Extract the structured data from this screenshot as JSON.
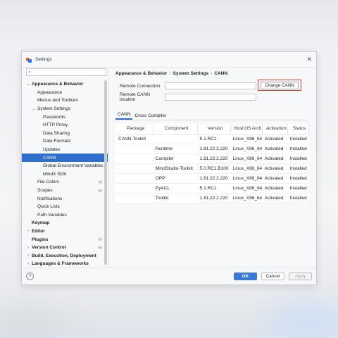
{
  "window": {
    "title": "Settings"
  },
  "sidebar": {
    "search_placeholder": "",
    "items": [
      {
        "label": "Appearance & Behavior",
        "depth": 0,
        "chevron": "expanded",
        "bold": true
      },
      {
        "label": "Appearance",
        "depth": 1
      },
      {
        "label": "Menus and Toolbars",
        "depth": 1
      },
      {
        "label": "System Settings",
        "depth": 1,
        "chevron": "expanded"
      },
      {
        "label": "Passwords",
        "depth": 2
      },
      {
        "label": "HTTP Proxy",
        "depth": 2
      },
      {
        "label": "Data Sharing",
        "depth": 2
      },
      {
        "label": "Date Formats",
        "depth": 2
      },
      {
        "label": "Updates",
        "depth": 2
      },
      {
        "label": "CANN",
        "depth": 2,
        "selected": true
      },
      {
        "label": "Global Environment Variables",
        "depth": 2
      },
      {
        "label": "MindX SDK",
        "depth": 2
      },
      {
        "label": "File Colors",
        "depth": 1,
        "page_icon": true
      },
      {
        "label": "Scopes",
        "depth": 1,
        "page_icon": true
      },
      {
        "label": "Notifications",
        "depth": 1
      },
      {
        "label": "Quick Lists",
        "depth": 1
      },
      {
        "label": "Path Variables",
        "depth": 1
      },
      {
        "label": "Keymap",
        "depth": 0,
        "bold": true
      },
      {
        "label": "Editor",
        "depth": 0,
        "chevron": "collapsed",
        "bold": true
      },
      {
        "label": "Plugins",
        "depth": 0,
        "bold": true,
        "page_icon": true
      },
      {
        "label": "Version Control",
        "depth": 0,
        "chevron": "collapsed",
        "bold": true,
        "page_icon": true
      },
      {
        "label": "Build, Execution, Deployment",
        "depth": 0,
        "chevron": "collapsed",
        "bold": true
      },
      {
        "label": "Languages & Frameworks",
        "depth": 0,
        "chevron": "collapsed",
        "bold": true
      }
    ]
  },
  "breadcrumb": [
    "Appearance & Behavior",
    "System Settings",
    "CANN"
  ],
  "form": {
    "remote_connection_label": "Remote Connection",
    "remote_connection_value": "",
    "remote_cann_location_label": "Remote CANN location",
    "remote_cann_location_value": "",
    "change_cann_label": "Change CANN"
  },
  "tabs": [
    "CANN",
    "Cross Compiler"
  ],
  "table": {
    "headers": [
      "Package",
      "Component",
      "Version",
      "Host OS Arch",
      "Activation",
      "Status"
    ],
    "rows": [
      [
        "CANN-Toolkit",
        "",
        "5.1.RC1",
        "Linux_X86_64",
        "Activated",
        "Installed"
      ],
      [
        "",
        "Runtime",
        "1.81.22.2.220",
        "Linux_X86_64",
        "Activated",
        "Installed"
      ],
      [
        "",
        "Compiler",
        "1.81.22.2.220",
        "Linux_X86_64",
        "Activated",
        "Installed"
      ],
      [
        "",
        "MindStudio-Toolkit",
        "5.0.RC1.B100",
        "Linux_X86_64",
        "Activated",
        "Installed"
      ],
      [
        "",
        "OPP",
        "1.81.22.2.220",
        "Linux_X86_64",
        "Activated",
        "Installed"
      ],
      [
        "",
        "PyACL",
        "5.1.RC1",
        "Linux_X86_64",
        "Activated",
        "Installed"
      ],
      [
        "",
        "Toolkit",
        "1.81.22.2.220",
        "Linux_X86_64",
        "Activated",
        "Installed"
      ]
    ]
  },
  "footer": {
    "help_label": "?",
    "ok_label": "OK",
    "cancel_label": "Cancel",
    "apply_label": "Apply"
  },
  "icons": {
    "close": "close-icon",
    "search": "search-icon",
    "help": "help-icon"
  },
  "colors": {
    "accent": "#2f6fc9",
    "primary_button": "#3a78d8",
    "highlight_box": "#e53935"
  }
}
